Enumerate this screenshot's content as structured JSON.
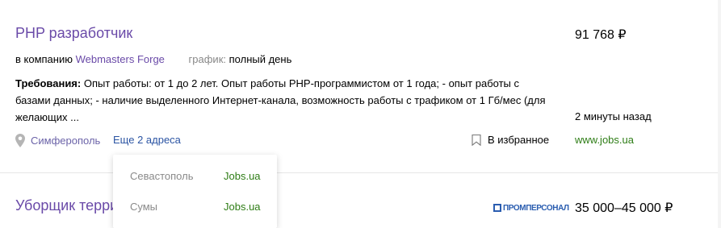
{
  "vacancies": [
    {
      "title": "PHP разработчик",
      "salary": "91 768 ₽",
      "company_prefix": "в компанию",
      "company": "Webmasters Forge",
      "schedule_label": "график:",
      "schedule_value": "полный день",
      "requirements_label": "Требования:",
      "requirements_text": "Опыт работы: от 1 до 2 лет. Опыт работы PHP-программистом от 1 года; - опыт работы с базами данных; - наличие выделенного Интернет-канала, возможность работы с трафиком от 1 Гб/мес (для желающих ...",
      "time_ago": "2 минуты назад",
      "location": "Симферополь",
      "more_addresses": "Еще 2 адреса",
      "favorites": "В избранное",
      "source": "www.jobs.ua"
    },
    {
      "title": "Уборщик терри",
      "salary": "35 000–45 000 ₽",
      "employer_logo_text": "ПРОМПЕРСОНАЛ"
    }
  ],
  "address_dropdown": [
    {
      "city": "Севастополь",
      "source": "Jobs.ua"
    },
    {
      "city": "Сумы",
      "source": "Jobs.ua"
    }
  ],
  "colors": {
    "title": "#6a4aa8",
    "link_blue": "#2b54a3",
    "source_green": "#2e7d16",
    "muted": "#888888"
  },
  "icons": {
    "location": "map-pin-icon",
    "favorites": "bookmark-icon"
  }
}
